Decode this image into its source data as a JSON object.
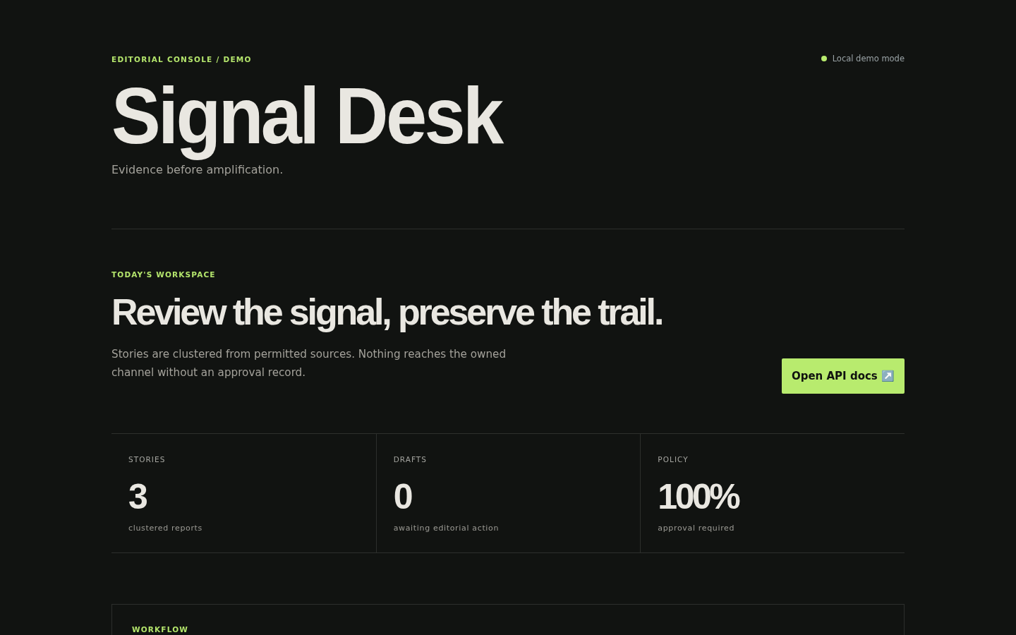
{
  "header": {
    "eyebrow": "EDITORIAL CONSOLE / DEMO",
    "status": "Local demo mode",
    "title": "Signal Desk",
    "tagline": "Evidence before amplification."
  },
  "workspace": {
    "eyebrow": "TODAY'S WORKSPACE",
    "heading": "Review the signal, preserve the trail.",
    "description": "Stories are clustered from permitted sources. Nothing reaches the owned channel without an approval record.",
    "button": "Open API docs ↗️"
  },
  "stats": [
    {
      "label": "STORIES",
      "value": "3",
      "caption": "clustered reports"
    },
    {
      "label": "DRAFTS",
      "value": "0",
      "caption": "awaiting editorial action"
    },
    {
      "label": "POLICY",
      "value": "100%",
      "caption": "approval required"
    }
  ],
  "workflow": {
    "eyebrow": "WORKFLOW"
  }
}
